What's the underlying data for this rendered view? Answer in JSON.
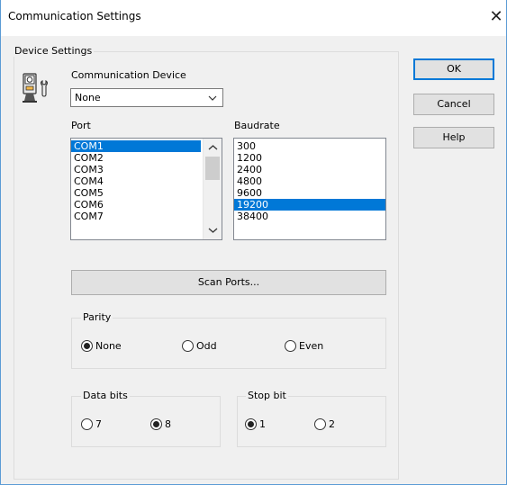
{
  "window": {
    "title": "Communication Settings",
    "close_glyph": "✕"
  },
  "device_settings": {
    "label": "Device Settings",
    "device_label": "Communication Device",
    "device_value": "None",
    "device_icon": "device-wrench-icon",
    "port_label": "Port",
    "ports": [
      "COM1",
      "COM2",
      "COM3",
      "COM4",
      "COM5",
      "COM6",
      "COM7"
    ],
    "port_selected": "COM1",
    "baud_label": "Baudrate",
    "baudrates": [
      "300",
      "1200",
      "2400",
      "4800",
      "9600",
      "19200",
      "38400"
    ],
    "baud_selected": "19200",
    "scan_label": "Scan Ports..."
  },
  "parity": {
    "label": "Parity",
    "options": [
      "None",
      "Odd",
      "Even"
    ],
    "selected": "None"
  },
  "data_bits": {
    "label": "Data bits",
    "options": [
      "7",
      "8"
    ],
    "selected": "8"
  },
  "stop_bit": {
    "label": "Stop bit",
    "options": [
      "1",
      "2"
    ],
    "selected": "1"
  },
  "buttons": {
    "ok": "OK",
    "cancel": "Cancel",
    "help": "Help"
  },
  "colors": {
    "selection": "#0078d7",
    "window_border": "#5b9bd5"
  }
}
